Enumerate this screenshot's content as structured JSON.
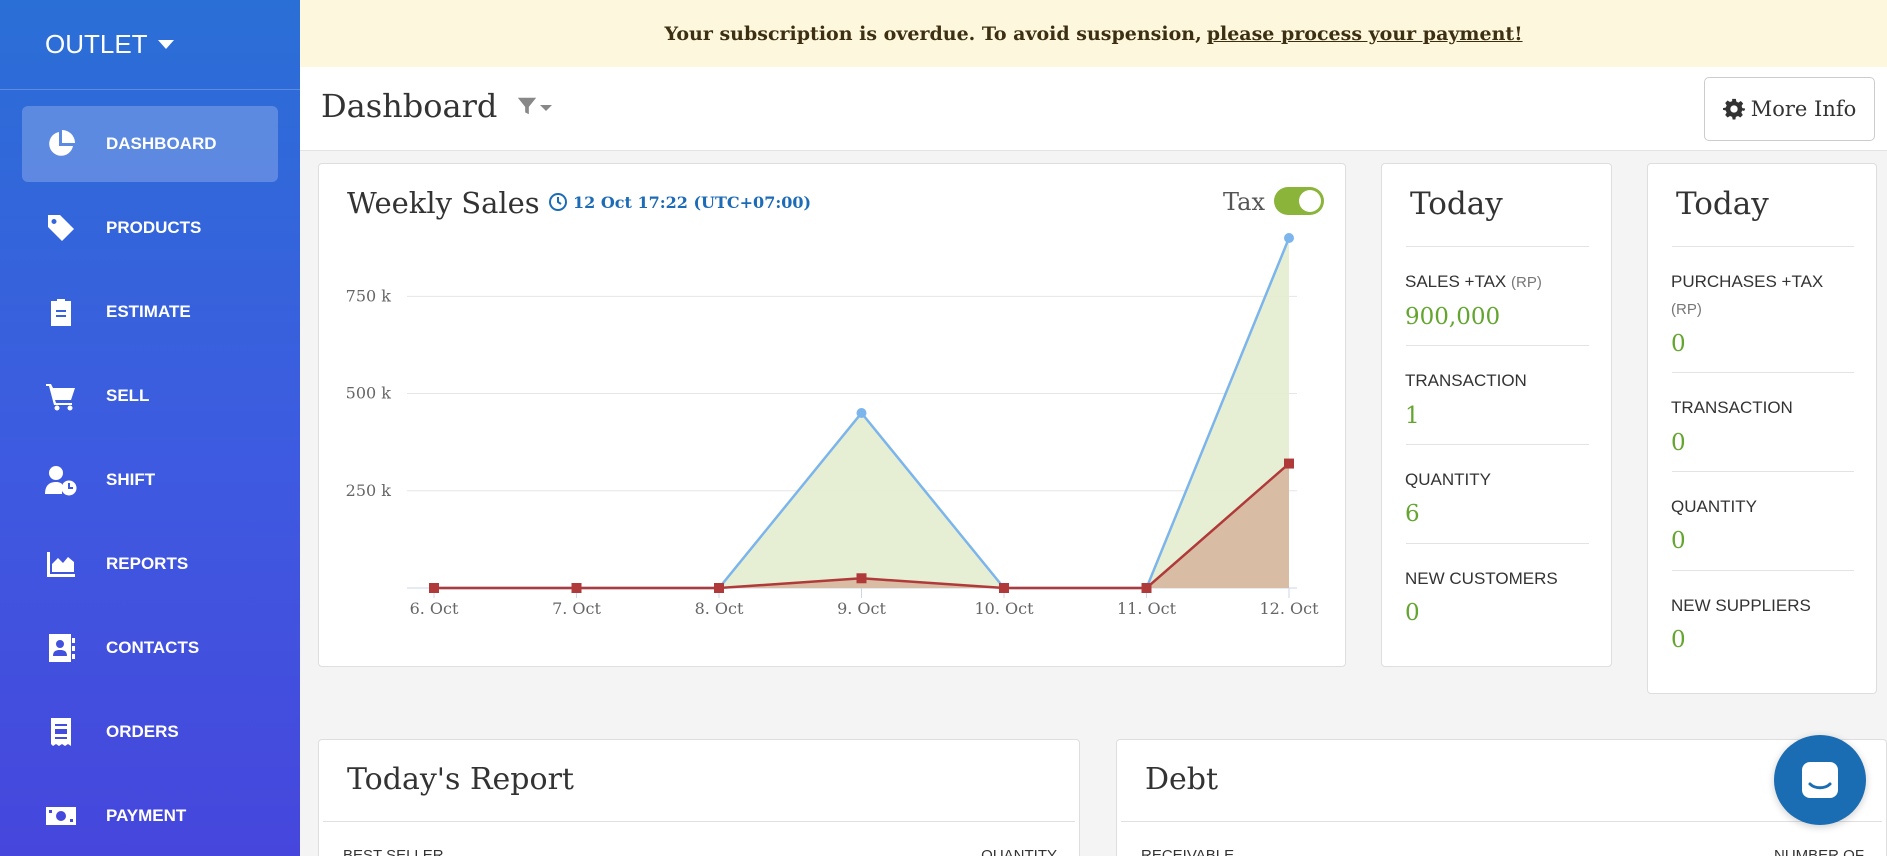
{
  "sidebar": {
    "outlet_label": "OUTLET",
    "items": [
      {
        "label": "DASHBOARD",
        "icon": "pie-chart-icon",
        "active": true
      },
      {
        "label": "PRODUCTS",
        "icon": "tag-icon"
      },
      {
        "label": "ESTIMATE",
        "icon": "clipboard-icon"
      },
      {
        "label": "SELL",
        "icon": "cart-icon"
      },
      {
        "label": "SHIFT",
        "icon": "user-clock-icon"
      },
      {
        "label": "REPORTS",
        "icon": "area-chart-icon"
      },
      {
        "label": "CONTACTS",
        "icon": "address-book-icon"
      },
      {
        "label": "ORDERS",
        "icon": "receipt-icon"
      },
      {
        "label": "PAYMENT",
        "icon": "money-bill-icon"
      }
    ]
  },
  "banner": {
    "text": "Your subscription is overdue. To avoid suspension,",
    "link": "please process your payment!"
  },
  "header": {
    "title": "Dashboard",
    "more_info": "More Info"
  },
  "weekly_sales": {
    "title": "Weekly Sales",
    "timestamp": "12 Oct 17:22 (UTC+07:00)",
    "tax_label": "Tax",
    "tax_enabled": true
  },
  "chart_data": {
    "type": "area",
    "categories": [
      "6. Oct",
      "7. Oct",
      "8. Oct",
      "9. Oct",
      "10. Oct",
      "11. Oct",
      "12. Oct"
    ],
    "y_ticks": [
      "250 k",
      "500 k",
      "750 k"
    ],
    "y_tick_values": [
      250000,
      500000,
      750000
    ],
    "ylim": [
      0,
      900000
    ],
    "grid": true,
    "series": [
      {
        "values": [
          0,
          0,
          0,
          450000,
          0,
          0,
          900000
        ],
        "color": "#7cb5ec",
        "fill": "#e3edcf",
        "marker": "circle"
      },
      {
        "values": [
          0,
          0,
          0,
          25000,
          0,
          0,
          320000
        ],
        "color": "#b03a3a",
        "fill": "#d6b79f",
        "marker": "square"
      }
    ]
  },
  "today_sales": {
    "title": "Today",
    "sales_label": "SALES +TAX",
    "sales_unit": "(RP)",
    "sales_value": "900,000",
    "transaction_label": "TRANSACTION",
    "transaction_value": "1",
    "quantity_label": "QUANTITY",
    "quantity_value": "6",
    "customers_label": "NEW CUSTOMERS",
    "customers_value": "0"
  },
  "today_purchases": {
    "title": "Today",
    "purchases_label": "PURCHASES +TAX",
    "purchases_unit": "(RP)",
    "purchases_value": "0",
    "transaction_label": "TRANSACTION",
    "transaction_value": "0",
    "quantity_label": "QUANTITY",
    "quantity_value": "0",
    "suppliers_label": "NEW SUPPLIERS",
    "suppliers_value": "0"
  },
  "report": {
    "title": "Today's Report",
    "col_left": "BEST SELLER",
    "col_right": "QUANTITY"
  },
  "debt": {
    "title": "Debt",
    "col_left": "RECEIVABLE",
    "col_right": "NUMBER OF"
  },
  "colors": {
    "accent": "#2a6fd6",
    "green": "#63a52f",
    "banner_bg": "#fdf7de",
    "link_blue": "#1c6bb7"
  }
}
